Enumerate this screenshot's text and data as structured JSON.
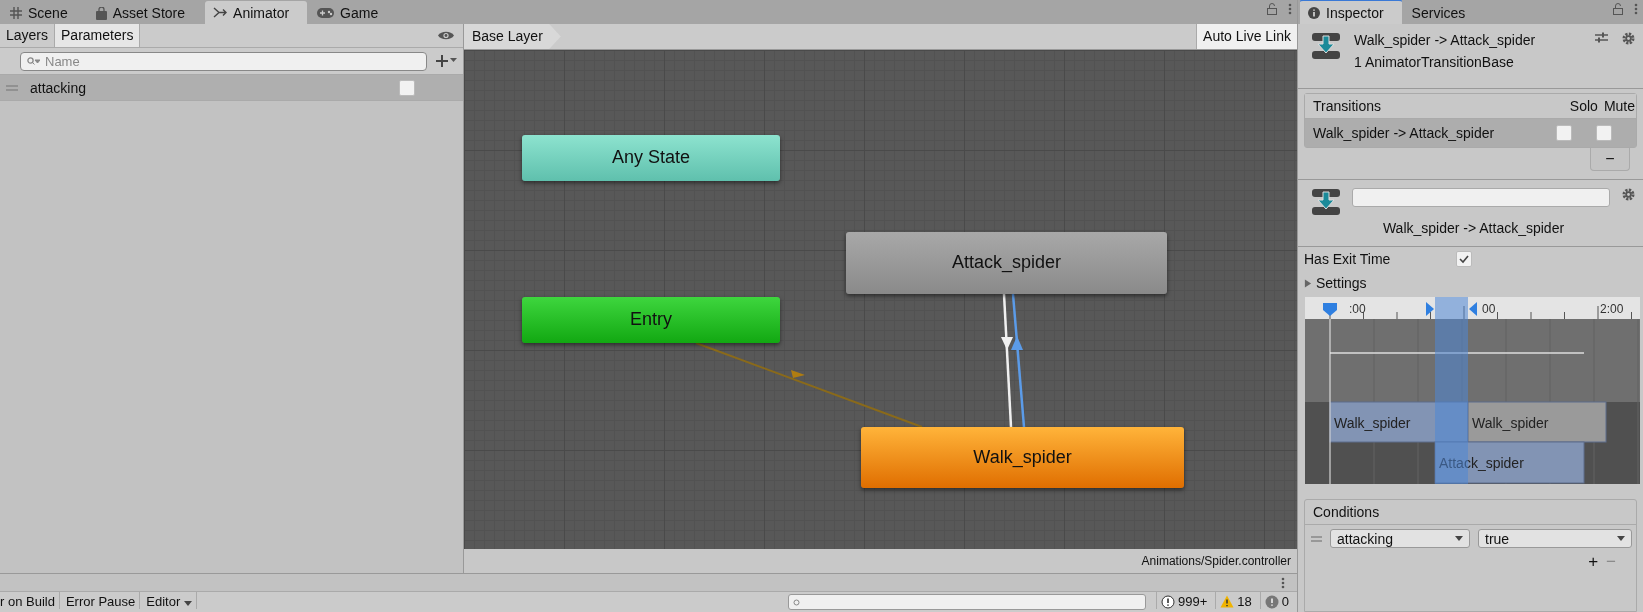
{
  "editor_tabs": [
    {
      "label": "Scene",
      "selected": false
    },
    {
      "label": "Asset Store",
      "selected": false
    },
    {
      "label": "Animator",
      "selected": true
    },
    {
      "label": "Game",
      "selected": false
    }
  ],
  "animator": {
    "layer_tabs": [
      {
        "label": "Layers",
        "selected": false
      },
      {
        "label": "Parameters",
        "selected": true
      }
    ],
    "search": {
      "placeholder": "Name"
    },
    "parameters": [
      {
        "name": "attacking",
        "checked": false
      }
    ],
    "breadcrumb": "Base Layer",
    "live_link": "Auto Live Link",
    "states": [
      {
        "label": "Any State",
        "kind": "any"
      },
      {
        "label": "Entry",
        "kind": "entry"
      },
      {
        "label": "Attack_spider",
        "kind": "state"
      },
      {
        "label": "Walk_spider",
        "kind": "default"
      }
    ],
    "footer_path": "Animations/Spider.controller"
  },
  "inspector_tabs": [
    {
      "label": "Inspector",
      "selected": true
    },
    {
      "label": "Services",
      "selected": false
    }
  ],
  "inspector": {
    "title": "Walk_spider -> Attack_spider",
    "subtitle": "1 AnimatorTransitionBase",
    "transitions": {
      "heading": "Transitions",
      "solo_heading": "Solo",
      "mute_heading": "Mute",
      "rows": [
        {
          "name": "Walk_spider -> Attack_spider",
          "selected": true,
          "solo": false,
          "mute": false
        }
      ],
      "remove_button": "−"
    },
    "transition_name": "Walk_spider -> Attack_spider",
    "has_exit_time": {
      "label": "Has Exit Time",
      "checked": true
    },
    "settings": {
      "label": "Settings",
      "expanded": false
    },
    "timeline": {
      "ruler_labels": [
        ":00",
        "00",
        "2:00"
      ],
      "clips": [
        {
          "label": "Walk_spider",
          "kind": "source"
        },
        {
          "label": "Walk_spider",
          "kind": "next"
        },
        {
          "label": "Attack_spider",
          "kind": "destination"
        }
      ]
    },
    "conditions": {
      "heading": "Conditions",
      "rows": [
        {
          "parameter": "attacking",
          "value": "true"
        }
      ],
      "add_button": "+",
      "remove_button": "−"
    }
  },
  "console": {
    "buttons": [
      "r on Build",
      "Error Pause"
    ],
    "dropdown": "Editor",
    "counts": [
      {
        "kind": "info",
        "text": "999+"
      },
      {
        "kind": "warning",
        "text": "18"
      },
      {
        "kind": "error",
        "text": "0"
      }
    ]
  }
}
